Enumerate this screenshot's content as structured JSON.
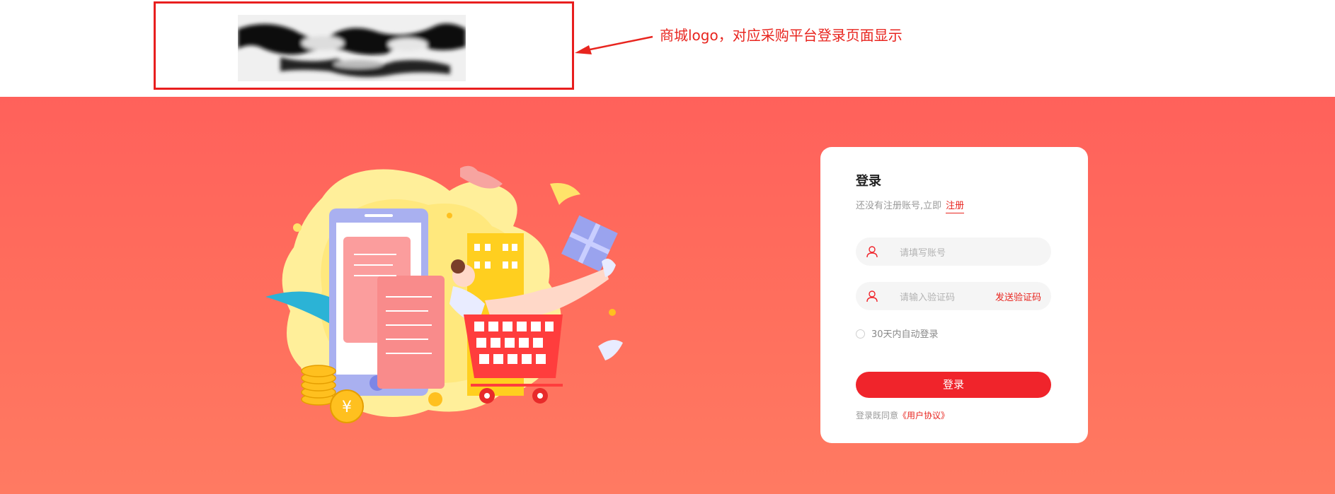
{
  "annotation": {
    "text": "商城logo，对应采购平台登录页面显示",
    "color": "#e8251f"
  },
  "login": {
    "title": "登录",
    "no_account_text": "还没有注册账号,立即",
    "register_link": "注册",
    "account_placeholder": "请填写账号",
    "code_placeholder": "请输入验证码",
    "send_code_label": "发送验证码",
    "remember_label": "30天内自动登录",
    "submit_label": "登录",
    "agree_prefix": "登录既同意",
    "agreement_link": "《用户协议》"
  },
  "colors": {
    "banner": "#ff655b",
    "accent": "#f0242b"
  },
  "icons": {
    "arrow": "arrow-left-icon",
    "user": "user-icon",
    "code": "user-icon"
  }
}
